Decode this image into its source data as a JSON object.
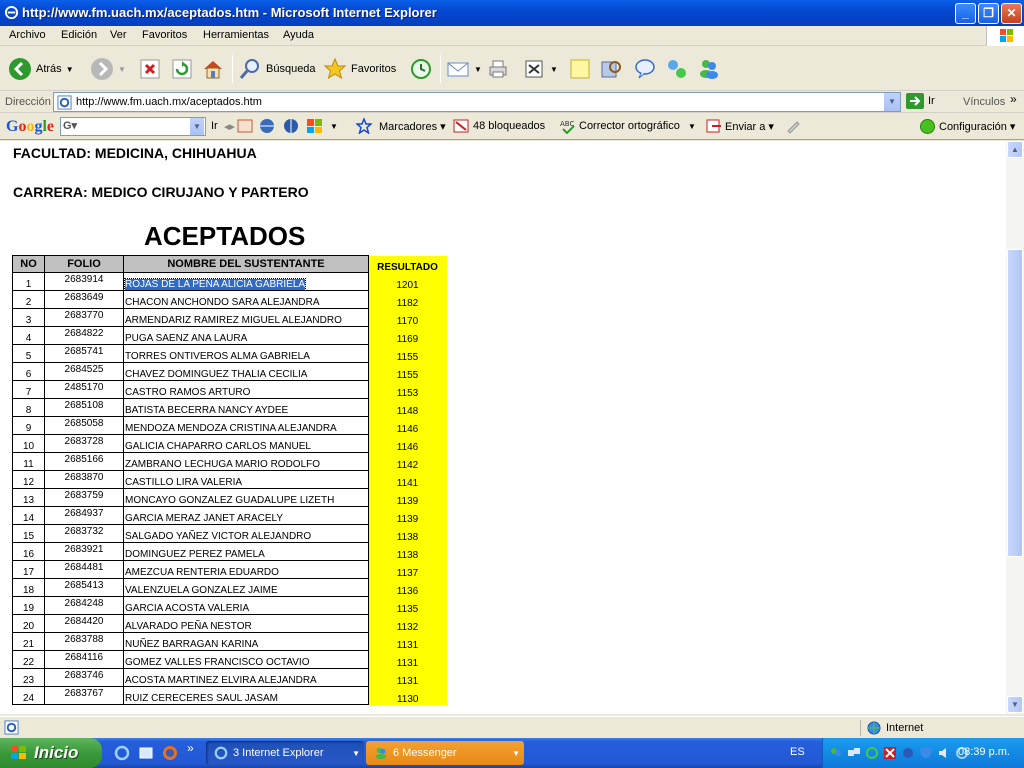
{
  "window": {
    "title": "http://www.fm.uach.mx/aceptados.htm - Microsoft Internet Explorer"
  },
  "menu": [
    "Archivo",
    "Edición",
    "Ver",
    "Favoritos",
    "Herramientas",
    "Ayuda"
  ],
  "toolbar": {
    "back": "Atrás",
    "search": "Búsqueda",
    "favorites": "Favoritos"
  },
  "address": {
    "label": "Dirección",
    "url": "http://www.fm.uach.mx/aceptados.htm",
    "go": "Ir",
    "links": "Vínculos"
  },
  "googlebar": {
    "logo": "Google",
    "go": "Ir",
    "bookmarks": "Marcadores",
    "blocked": "48 bloqueados",
    "spell": "Corrector ortográfico",
    "send": "Enviar a",
    "settings": "Configuración"
  },
  "page": {
    "faculty": "FACULTAD: MEDICINA, CHIHUAHUA",
    "career": "CARRERA: MEDICO CIRUJANO Y PARTERO",
    "heading": "ACEPTADOS",
    "columns": {
      "no": "NO",
      "folio": "FOLIO",
      "name": "NOMBRE DEL SUSTENTANTE",
      "result": "RESULTADO"
    },
    "rows": [
      {
        "no": "1",
        "folio": "2683914",
        "name": "ROJAS DE LA PEÑA ALICIA GABRIELA",
        "result": "1201"
      },
      {
        "no": "2",
        "folio": "2683649",
        "name": "CHACON ANCHONDO SARA ALEJANDRA",
        "result": "1182"
      },
      {
        "no": "3",
        "folio": "2683770",
        "name": "ARMENDARIZ RAMIREZ MIGUEL ALEJANDRO",
        "result": "1170"
      },
      {
        "no": "4",
        "folio": "2684822",
        "name": "PUGA SAENZ ANA LAURA",
        "result": "1169"
      },
      {
        "no": "5",
        "folio": "2685741",
        "name": "TORRES ONTIVEROS ALMA GABRIELA",
        "result": "1155"
      },
      {
        "no": "6",
        "folio": "2684525",
        "name": "CHAVEZ DOMINGUEZ THALIA CECILIA",
        "result": "1155"
      },
      {
        "no": "7",
        "folio": "2485170",
        "name": "CASTRO RAMOS ARTURO",
        "result": "1153"
      },
      {
        "no": "8",
        "folio": "2685108",
        "name": "BATISTA BECERRA NANCY AYDEE",
        "result": "1148"
      },
      {
        "no": "9",
        "folio": "2685058",
        "name": "MENDOZA MENDOZA CRISTINA ALEJANDRA",
        "result": "1146"
      },
      {
        "no": "10",
        "folio": "2683728",
        "name": "GALICIA CHAPARRO CARLOS MANUEL",
        "result": "1146"
      },
      {
        "no": "11",
        "folio": "2685166",
        "name": "ZAMBRANO LECHUGA MARIO RODOLFO",
        "result": "1142"
      },
      {
        "no": "12",
        "folio": "2683870",
        "name": "CASTILLO LIRA VALERIA",
        "result": "1141"
      },
      {
        "no": "13",
        "folio": "2683759",
        "name": "MONCAYO GONZALEZ GUADALUPE LIZETH",
        "result": "1139"
      },
      {
        "no": "14",
        "folio": "2684937",
        "name": "GARCIA MERAZ JANET ARACELY",
        "result": "1139"
      },
      {
        "no": "15",
        "folio": "2683732",
        "name": "SALGADO YAÑEZ VICTOR ALEJANDRO",
        "result": "1138"
      },
      {
        "no": "16",
        "folio": "2683921",
        "name": "DOMINGUEZ PEREZ PAMELA",
        "result": "1138"
      },
      {
        "no": "17",
        "folio": "2684481",
        "name": "AMEZCUA RENTERIA EDUARDO",
        "result": "1137"
      },
      {
        "no": "18",
        "folio": "2685413",
        "name": "VALENZUELA GONZALEZ JAIME",
        "result": "1136"
      },
      {
        "no": "19",
        "folio": "2684248",
        "name": "GARCIA ACOSTA VALERIA",
        "result": "1135"
      },
      {
        "no": "20",
        "folio": "2684420",
        "name": "ALVARADO PEÑA NESTOR",
        "result": "1132"
      },
      {
        "no": "21",
        "folio": "2683788",
        "name": "NUÑEZ BARRAGAN KARINA",
        "result": "1131"
      },
      {
        "no": "22",
        "folio": "2684116",
        "name": "GOMEZ VALLES FRANCISCO OCTAVIO",
        "result": "1131"
      },
      {
        "no": "23",
        "folio": "2683746",
        "name": "ACOSTA MARTINEZ ELVIRA ALEJANDRA",
        "result": "1131"
      },
      {
        "no": "24",
        "folio": "2683767",
        "name": "RUIZ CERECERES SAUL JASAM",
        "result": "1130"
      }
    ]
  },
  "status": {
    "zone": "Internet"
  },
  "taskbar": {
    "start": "Inicio",
    "task1": "3 Internet Explorer",
    "task2": "6 Messenger",
    "lang": "ES",
    "clock": "08:39 p.m."
  },
  "colors": {
    "titlebar": "#0548d0",
    "highlight": "#316ac5",
    "result_bg": "#ffff00",
    "header_bg": "#c0c0c0",
    "taskbar": "#245edb",
    "start": "#3a9a3a"
  }
}
